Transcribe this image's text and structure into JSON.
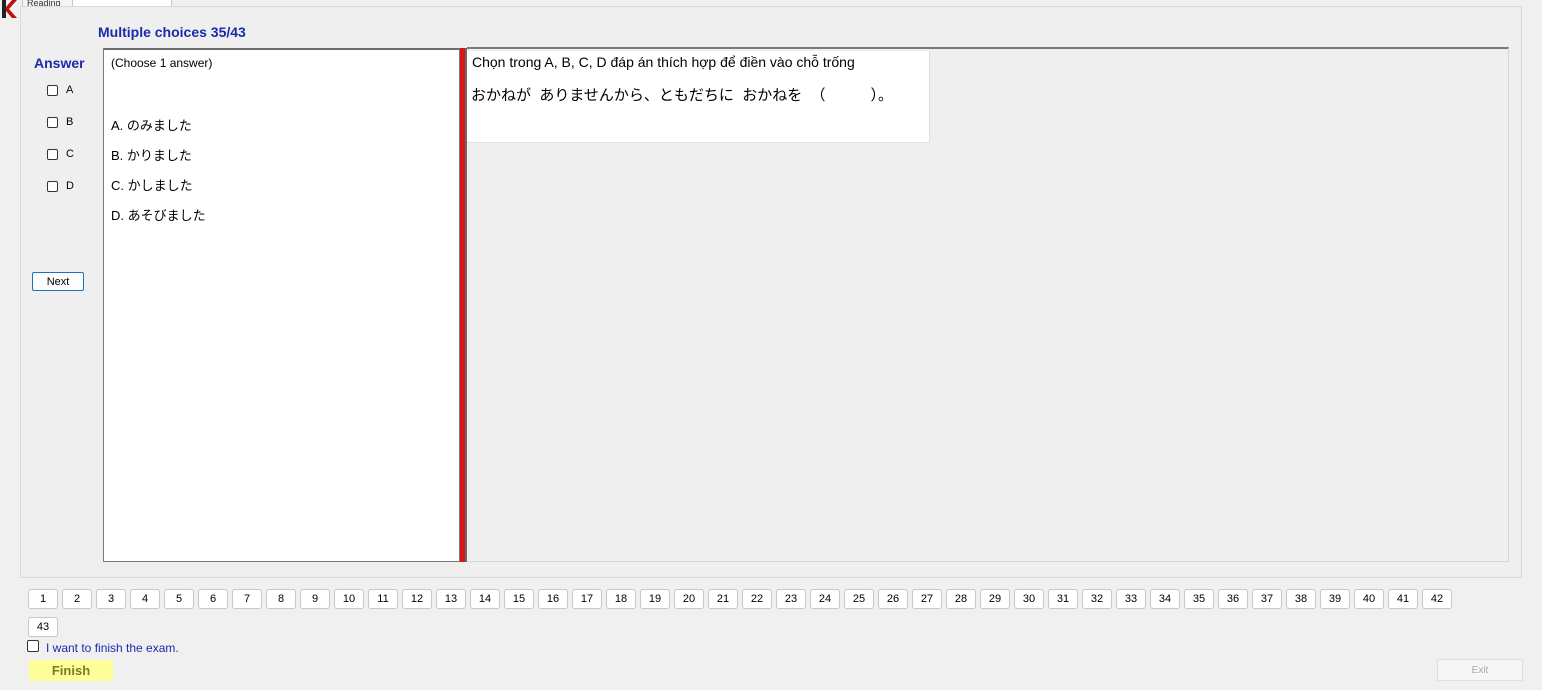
{
  "top_tabs": [
    "Reading",
    ""
  ],
  "title": "Multiple choices 35/43",
  "answer": {
    "label": "Answer",
    "options": [
      "A",
      "B",
      "C",
      "D"
    ],
    "checked": [
      false,
      false,
      false,
      false
    ]
  },
  "next_label": "Next",
  "choices": {
    "note": "(Choose 1 answer)",
    "options": [
      "A.  のみました",
      "B.  かりました",
      "C.  かしました",
      "D.  あそびました"
    ]
  },
  "question": {
    "instruction": "Chọn trong A, B, C, D đáp án thích hợp để điền vào chỗ trống",
    "sentence": "おかねが  ありませんから、ともだちに  おかねを  （　　　）。"
  },
  "question_numbers": [
    "1",
    "2",
    "3",
    "4",
    "5",
    "6",
    "7",
    "8",
    "9",
    "10",
    "11",
    "12",
    "13",
    "14",
    "15",
    "16",
    "17",
    "18",
    "19",
    "20",
    "21",
    "22",
    "23",
    "24",
    "25",
    "26",
    "27",
    "28",
    "29",
    "30",
    "31",
    "32",
    "33",
    "34",
    "35",
    "36",
    "37",
    "38",
    "39",
    "40",
    "41",
    "42",
    "43"
  ],
  "finish_checkbox_label": "I want to finish the exam.",
  "finish_label": "Finish",
  "exit_label": "Exit",
  "colors": {
    "title": "#1a2aa8",
    "divider": "#d81717",
    "finish_bg": "#ffff9a"
  }
}
